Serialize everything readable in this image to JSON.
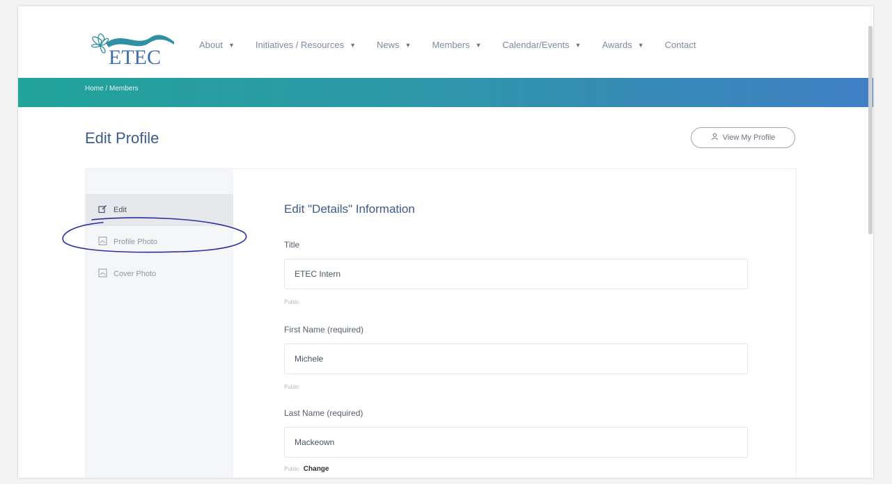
{
  "brand": {
    "logo_text": "ETEC"
  },
  "nav": {
    "items": [
      {
        "label": "About",
        "dropdown": true
      },
      {
        "label": "Initiatives / Resources",
        "dropdown": true
      },
      {
        "label": "News",
        "dropdown": true
      },
      {
        "label": "Members",
        "dropdown": true
      },
      {
        "label": "Calendar/Events",
        "dropdown": true
      },
      {
        "label": "Awards",
        "dropdown": true
      },
      {
        "label": "Contact",
        "dropdown": false
      }
    ],
    "caret_glyph": "▼"
  },
  "breadcrumb": "Home / Members",
  "page_title": "Edit Profile",
  "view_profile_button": {
    "label": "View My Profile",
    "icon": "user-icon"
  },
  "sidebar": {
    "items": [
      {
        "label": "Edit",
        "icon": "edit-icon",
        "active": true
      },
      {
        "label": "Profile Photo",
        "icon": "image-icon",
        "active": false
      },
      {
        "label": "Cover Photo",
        "icon": "image-icon",
        "active": false
      }
    ]
  },
  "form": {
    "title": "Edit \"Details\" Information",
    "fields": [
      {
        "label": "Title",
        "value": "ETEC Intern",
        "visibility": "Public"
      },
      {
        "label": "First Name (required)",
        "value": "Michele",
        "visibility": "Public"
      },
      {
        "label": "Last Name (required)",
        "value": "Mackeown",
        "visibility": "Public",
        "change_label": "Change"
      }
    ]
  },
  "colors": {
    "brand_blue": "#3d5a8c",
    "band_start": "#21a39a",
    "band_end": "#3f7fc4",
    "annotation_ink": "#2b2f9e"
  }
}
